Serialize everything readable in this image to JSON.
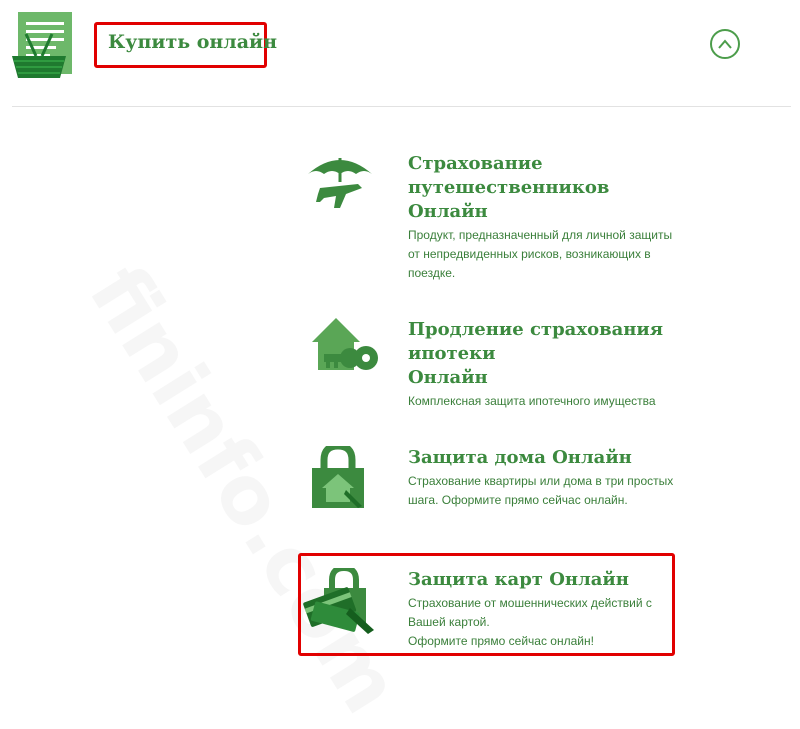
{
  "header": {
    "title": "Купить онлайн",
    "icon": "shopping-basket-icon",
    "toggle_icon": "chevron-up-icon"
  },
  "products": [
    {
      "title_line1": "Страхование путешественников",
      "title_line2": "Онлайн",
      "description": "Продукт, предназначенный для личной защиты\nот непредвиденных рисков, возникающих в\nпоездке.",
      "icon": "umbrella-plane-icon"
    },
    {
      "title_line1": "Продление страхования ипотеки",
      "title_line2": "Онлайн",
      "description": "Комплексная защита ипотечного имущества",
      "icon": "house-key-icon"
    },
    {
      "title_line1": "Защита дома Онлайн",
      "title_line2": "",
      "description": "Страхование квартиры или дома в три простых\nшага. Оформите прямо сейчас онлайн.",
      "icon": "padlock-house-icon"
    },
    {
      "title_line1": "Защита карт Онлайн",
      "title_line2": "",
      "description": "Страхование от мошеннических действий с\nВашей картой.\nОформите прямо сейчас онлайн!",
      "icon": "padlock-cards-icon"
    }
  ],
  "watermark": "fininfo.com",
  "colors": {
    "accent_green": "#3c8a3f",
    "icon_green": "#4c9d4b",
    "highlight_red": "#e10000"
  }
}
